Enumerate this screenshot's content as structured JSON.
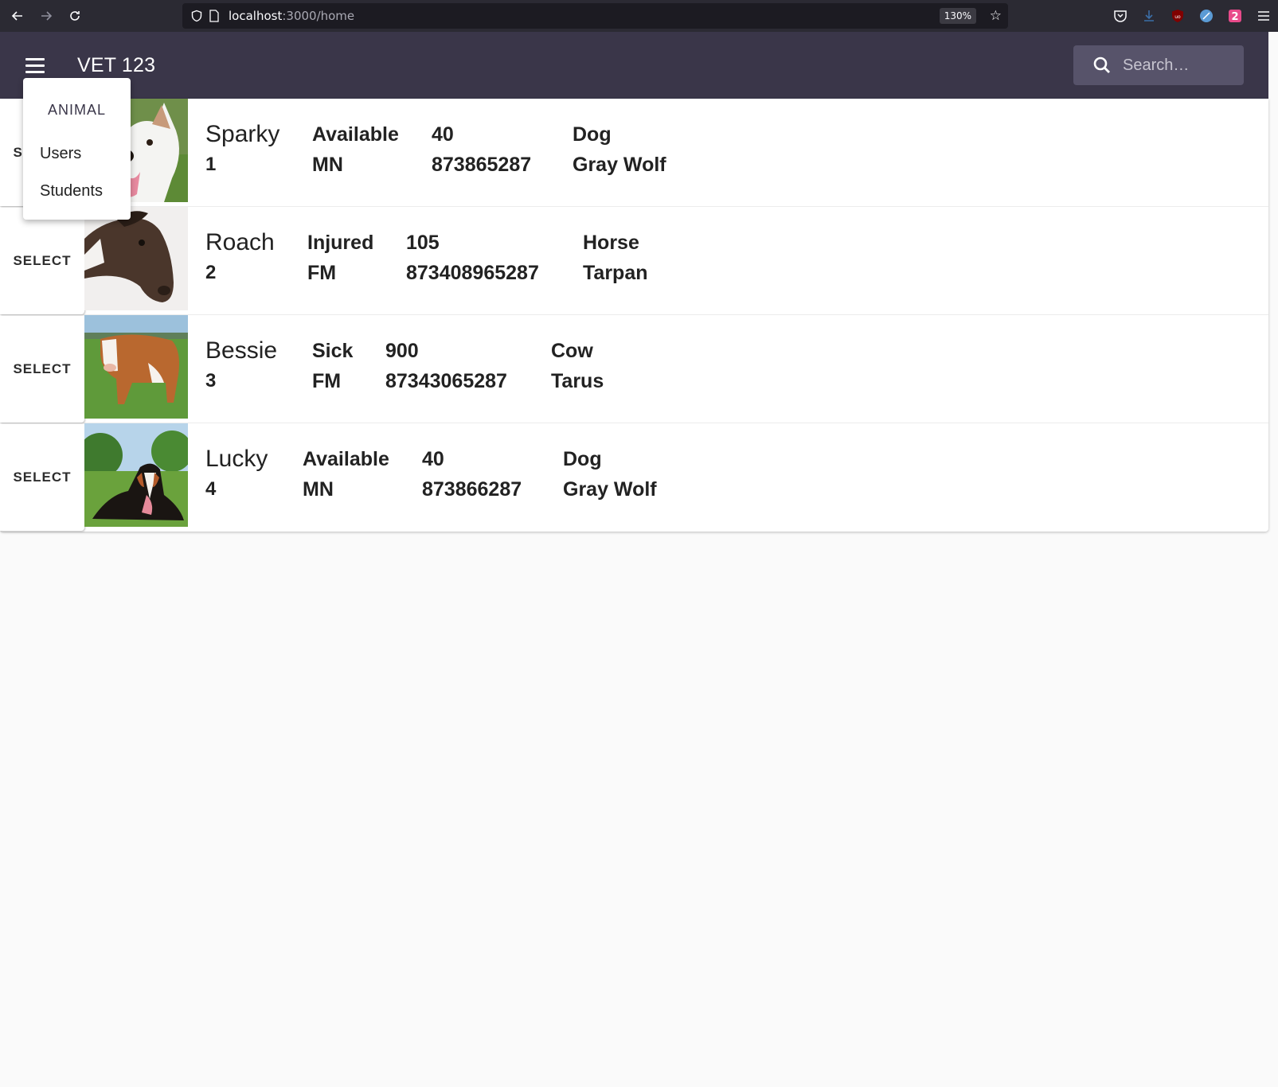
{
  "browser": {
    "url_host": "localhost",
    "url_path": ":3000/home",
    "zoom": "130%"
  },
  "app": {
    "title": "VET 123",
    "search_placeholder": "Search…"
  },
  "menu": {
    "header": "ANIMAL",
    "items": [
      "Users",
      "Students"
    ]
  },
  "animals": [
    {
      "select_label": "SELECT",
      "name": "Sparky",
      "id": "1",
      "status": "Available",
      "sex": "MN",
      "weight": "40",
      "tattoo": "873865287",
      "species": "Dog",
      "breed": "Gray Wolf",
      "image": "white dog photo"
    },
    {
      "select_label": "SELECT",
      "name": "Roach",
      "id": "2",
      "status": "Injured",
      "sex": "FM",
      "weight": "105",
      "tattoo": "873408965287",
      "species": "Horse",
      "breed": "Tarpan",
      "image": "brown horse photo"
    },
    {
      "select_label": "SELECT",
      "name": "Bessie",
      "id": "3",
      "status": "Sick",
      "sex": "FM",
      "weight": "900",
      "tattoo": "87343065287",
      "species": "Cow",
      "breed": "Tarus",
      "image": "brown and white cow photo"
    },
    {
      "select_label": "SELECT",
      "name": "Lucky",
      "id": "4",
      "status": "Available",
      "sex": "MN",
      "weight": "40",
      "tattoo": "873866287",
      "species": "Dog",
      "breed": "Gray Wolf",
      "image": "bernese mountain dog photo"
    }
  ]
}
